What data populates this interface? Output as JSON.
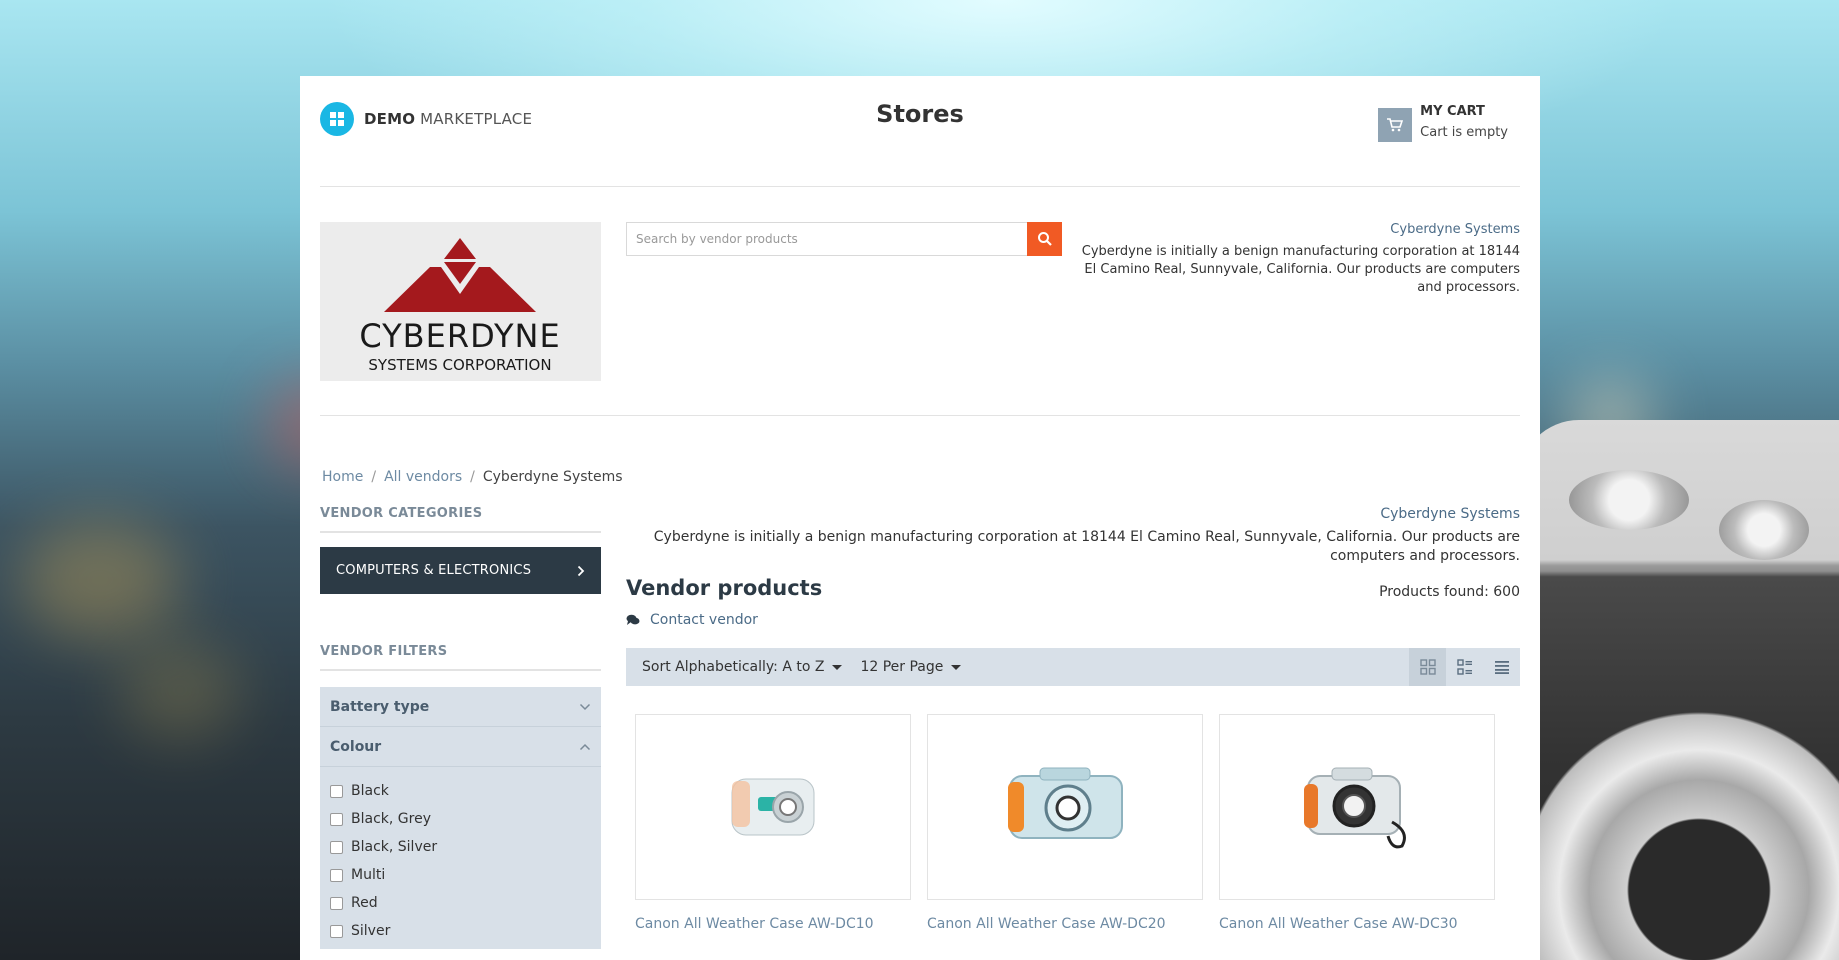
{
  "header": {
    "logo_bold": "DEMO",
    "logo_rest": "MARKETPLACE",
    "title": "Stores",
    "cart_title": "MY CART",
    "cart_status": "Cart is empty"
  },
  "vendor": {
    "logo_main": "CYBERDYNE",
    "logo_sub": "SYSTEMS CORPORATION",
    "name": "Cyberdyne Systems",
    "description": "Cyberdyne is initially a benign manufacturing corporation at 18144 El Camino Real, Sunnyvale, California. Our products are computers and processors."
  },
  "search": {
    "placeholder": "Search by vendor products",
    "value": ""
  },
  "breadcrumb": {
    "home": "Home",
    "sep": "/",
    "all_vendors": "All vendors",
    "current": "Cyberdyne Systems"
  },
  "sidebar": {
    "categories_heading": "VENDOR CATEGORIES",
    "category": "COMPUTERS & ELECTRONICS",
    "filters_heading": "VENDOR FILTERS",
    "filters": [
      {
        "label": "Battery type",
        "expanded": false
      },
      {
        "label": "Colour",
        "expanded": true
      }
    ],
    "colour_options": [
      "Black",
      "Black, Grey",
      "Black, Silver",
      "Multi",
      "Red",
      "Silver"
    ]
  },
  "main": {
    "vendor_name": "Cyberdyne Systems",
    "vendor_description": "Cyberdyne is initially a benign manufacturing corporation at 18144 El Camino Real, Sunnyvale, California. Our products are computers and processors.",
    "title": "Vendor products",
    "products_found": "Products found: 600",
    "contact": "Contact vendor",
    "sort_label": "Sort Alphabetically: A to Z",
    "per_page_label": "12 Per Page",
    "view_modes": [
      "grid-icon",
      "list-icon",
      "compact-list-icon"
    ],
    "products": [
      {
        "name": "Canon All Weather Case AW-DC10"
      },
      {
        "name": "Canon All Weather Case AW-DC20"
      },
      {
        "name": "Canon All Weather Case AW-DC30"
      }
    ]
  },
  "colors": {
    "accent": "#1ab7e4",
    "search_button": "#f15a24",
    "dark_nav": "#2c3a45",
    "filter_bg": "#d8e0e8",
    "link": "#6d8aa3"
  }
}
